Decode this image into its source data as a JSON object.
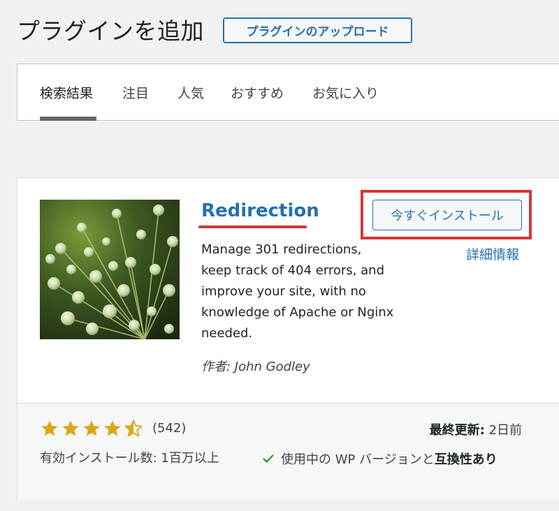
{
  "header": {
    "title": "プラグインを追加",
    "upload_label": "プラグインのアップロード"
  },
  "tabs": [
    {
      "label": "検索結果",
      "active": true
    },
    {
      "label": "注目"
    },
    {
      "label": "人気"
    },
    {
      "label": "おすすめ"
    },
    {
      "label": "お気に入り"
    }
  ],
  "plugin": {
    "name": "Redirection",
    "install_label": "今すぐインストール",
    "details_label": "詳細情報",
    "description": "Manage 301 redirections, keep track of 404 errors, and improve your site, with no knowledge of Apache or Nginx needed.",
    "author": "作者: John Godley",
    "rating_stars": 4.5,
    "rating_count": "(542)",
    "installs": "有効インストール数: 1百万以上",
    "last_updated_label": "最終更新:",
    "last_updated_value": "2日前",
    "compat_prefix": "使用中の WP バージョンと",
    "compat_status": "互換性あり"
  },
  "colors": {
    "accent": "#2271b1",
    "highlight": "#d63638",
    "star": "#dba617",
    "check": "#00a32a"
  },
  "icons": {
    "rating": "star-icon",
    "compat": "checkmark-icon"
  }
}
